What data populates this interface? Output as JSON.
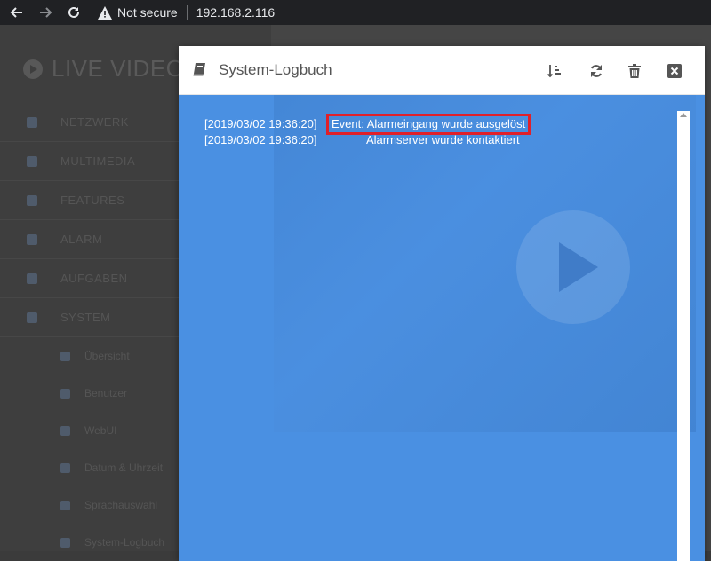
{
  "browser": {
    "security_label": "Not secure",
    "url": "192.168.2.116"
  },
  "app": {
    "brand": "LIVE VIDEO",
    "menu": [
      {
        "label": "NETZWERK"
      },
      {
        "label": "MULTIMEDIA"
      },
      {
        "label": "FEATURES"
      },
      {
        "label": "ALARM"
      },
      {
        "label": "AUFGABEN"
      },
      {
        "label": "SYSTEM"
      }
    ],
    "submenu": [
      {
        "label": "Übersicht"
      },
      {
        "label": "Benutzer"
      },
      {
        "label": "WebUI"
      },
      {
        "label": "Datum & Uhrzeit"
      },
      {
        "label": "Sprachauswahl"
      },
      {
        "label": "System-Logbuch"
      }
    ]
  },
  "modal": {
    "title": "System-Logbuch",
    "log": [
      {
        "timestamp": "[2019/03/02 19:36:20]",
        "event": "Event: Alarmeingang wurde ausgelöst",
        "highlighted": true
      },
      {
        "timestamp": "[2019/03/02 19:36:20]",
        "event": "Alarmserver wurde kontaktiert",
        "highlighted": false
      }
    ]
  },
  "colors": {
    "modal_body": "#4a90e2",
    "highlight_border": "#e0202a"
  }
}
